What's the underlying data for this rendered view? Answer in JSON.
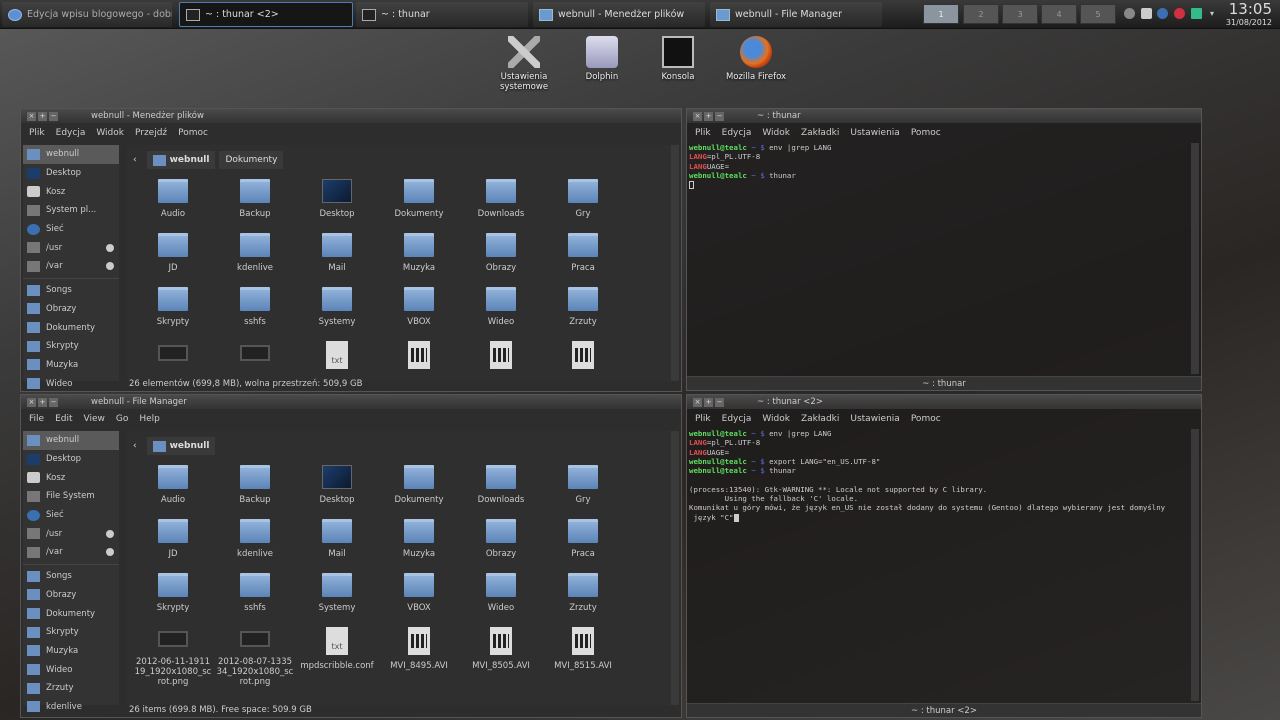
{
  "taskbar": {
    "tasks": [
      {
        "label": "Edycja wpisu blogowego - dobreprogramy",
        "icon": "firefox-icon",
        "active": false
      },
      {
        "label": "~ : thunar <2>",
        "icon": "terminal-icon",
        "active": true
      },
      {
        "label": "~ : thunar",
        "icon": "terminal-icon",
        "active": false
      },
      {
        "label": "webnull - Menedżer plików",
        "icon": "file-manager-icon",
        "active": false
      },
      {
        "label": "webnull - File Manager",
        "icon": "file-manager-icon",
        "active": false
      }
    ],
    "desktops": [
      "1",
      "2",
      "3",
      "4",
      "5"
    ],
    "active_desktop": "1",
    "clock": {
      "time": "13:05",
      "date": "31/08/2012"
    }
  },
  "launchers": [
    {
      "label": "Ustawienia systemowe",
      "icon": "settings-tools-icon"
    },
    {
      "label": "Dolphin",
      "icon": "dolphin-icon"
    },
    {
      "label": "Konsola",
      "icon": "konsole-icon"
    },
    {
      "label": "Mozilla Firefox",
      "icon": "firefox-icon"
    }
  ],
  "fm_pl": {
    "title": "webnull - Menedżer plików",
    "menu": [
      "Plik",
      "Edycja",
      "Widok",
      "Przejdź",
      "Pomoc"
    ],
    "sidebar": [
      "webnull",
      "Desktop",
      "Kosz",
      "System pl...",
      "Sieć",
      "/usr",
      "/var",
      "Songs",
      "Obrazy",
      "Dokumenty",
      "Skrypty",
      "Muzyka",
      "Wideo"
    ],
    "crumbs": [
      "webnull",
      "Dokumenty"
    ],
    "files": [
      "Audio",
      "Backup",
      "Desktop",
      "Dokumenty",
      "Downloads",
      "Gry",
      "JD",
      "kdenlive",
      "Mail",
      "Muzyka",
      "Obrazy",
      "Praca",
      "Skrypty",
      "sshfs",
      "Systemy",
      "VBOX",
      "Wideo",
      "Zrzuty",
      "",
      "",
      "",
      "",
      "",
      ""
    ],
    "status": "26 elementów (699,8 MB), wolna przestrzeń: 509,9 GB"
  },
  "fm_en": {
    "title": "webnull - File Manager",
    "menu": [
      "File",
      "Edit",
      "View",
      "Go",
      "Help"
    ],
    "sidebar": [
      "webnull",
      "Desktop",
      "Kosz",
      "File System",
      "Sieć",
      "/usr",
      "/var",
      "Songs",
      "Obrazy",
      "Dokumenty",
      "Skrypty",
      "Muzyka",
      "Wideo",
      "Zrzuty",
      "kdenlive"
    ],
    "crumbs": [
      "webnull"
    ],
    "files": [
      "Audio",
      "Backup",
      "Desktop",
      "Dokumenty",
      "Downloads",
      "Gry",
      "JD",
      "kdenlive",
      "Mail",
      "Muzyka",
      "Obrazy",
      "Praca",
      "Skrypty",
      "sshfs",
      "Systemy",
      "VBOX",
      "Wideo",
      "Zrzuty",
      "2012-06-11-191119_1920x1080_scrot.png",
      "2012-08-07-133534_1920x1080_scrot.png",
      "mpdscribble.conf",
      "MVI_8495.AVI",
      "MVI_8505.AVI",
      "MVI_8515.AVI"
    ],
    "status": "26 items (699.8 MB). Free space: 509.9 GB"
  },
  "term1": {
    "title": "~ : thunar",
    "menu": [
      "Plik",
      "Edycja",
      "Widok",
      "Zakładki",
      "Ustawienia",
      "Pomoc"
    ],
    "prompt_user": "webnull@tealc",
    "prompt_path": " ~ $ ",
    "cmd1": "env |grep LANG",
    "out1a": "LANG",
    "out1b": "=pl_PL.UTF-8",
    "out2a": "LANG",
    "out2b": "UAGE=",
    "cmd2": "thunar",
    "status": "~ : thunar"
  },
  "term2": {
    "title": "~ : thunar <2>",
    "menu": [
      "Plik",
      "Edycja",
      "Widok",
      "Zakładki",
      "Ustawienia",
      "Pomoc"
    ],
    "prompt_user": "webnull@tealc",
    "prompt_path": " ~ $ ",
    "cmd1": "env |grep LANG",
    "out1a": "LANG",
    "out1b": "=pl_PL.UTF-8",
    "out2a": "LANG",
    "out2b": "UAGE=",
    "cmd2": "export LANG=\"en_US.UTF-8\"",
    "cmd3": "thunar",
    "warn1": "(process:13540): Gtk-WARNING **: Locale not supported by C library.",
    "warn2": "        Using the fallback 'C' locale.",
    "note1": "Komunikat u góry mówi, że język en_US nie został dodany do systemu (Gentoo) dlatego wybierany jest domyślny",
    "note2": " język \"C\"",
    "status": "~ : thunar <2>"
  }
}
